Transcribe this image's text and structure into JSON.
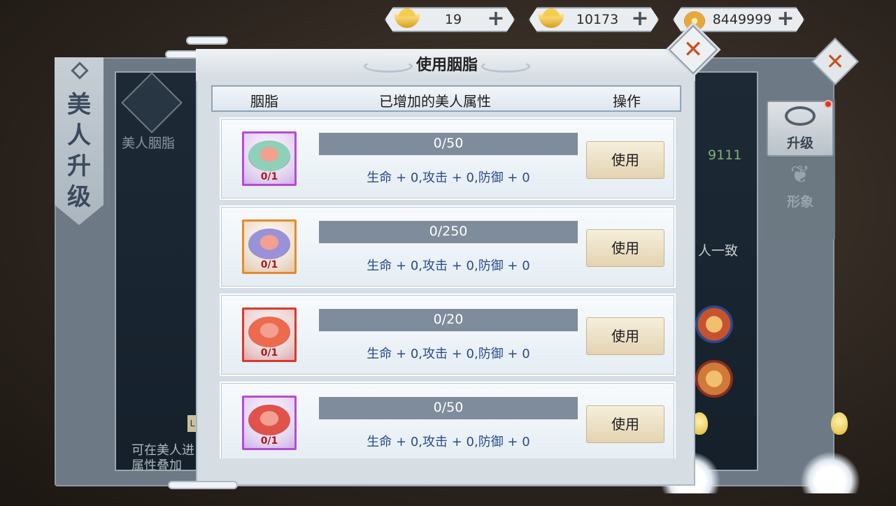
{
  "currencies": [
    {
      "icon": "locked-ingot-icon",
      "value": "19"
    },
    {
      "icon": "gold-ingot-icon",
      "value": "10173"
    },
    {
      "icon": "copper-coin-icon",
      "value": "8449999"
    }
  ],
  "background": {
    "side_title": "美人升级",
    "section_label": "美人胭脂",
    "number": "9111",
    "text_right": "人一致",
    "level_badge": "L",
    "hint_line1": "可在美人进",
    "hint_line2": "属性叠加",
    "tabs": [
      {
        "label": "升级",
        "icon": "upgrade-icon"
      },
      {
        "label": "形象",
        "icon": "appearance-icon"
      }
    ]
  },
  "dialog": {
    "title": "使用胭脂",
    "headers": {
      "item": "胭脂",
      "attributes": "已增加的美人属性",
      "action": "操作"
    },
    "rows": [
      {
        "progress": "0/50",
        "count": "0/1",
        "attributes": "生命 + 0,攻击 + 0,防御 + 0",
        "button": "使用",
        "quality_color": "#b64bd6",
        "rouge_color": "#8fd0b8",
        "icon": "rouge-jade-box-icon"
      },
      {
        "progress": "0/250",
        "count": "0/1",
        "attributes": "生命 + 0,攻击 + 0,防御 + 0",
        "button": "使用",
        "quality_color": "#e58a2a",
        "rouge_color": "#9a92d8",
        "icon": "rouge-violet-box-icon"
      },
      {
        "progress": "0/20",
        "count": "0/1",
        "attributes": "生命 + 0,攻击 + 0,防御 + 0",
        "button": "使用",
        "quality_color": "#d9392e",
        "rouge_color": "#ee6a4e",
        "icon": "rouge-red-box-icon"
      },
      {
        "progress": "0/50",
        "count": "0/1",
        "attributes": "生命 + 0,攻击 + 0,防御 + 0",
        "button": "使用",
        "quality_color": "#b64bd6",
        "rouge_color": "#e0524a",
        "icon": "rouge-ornate-box-icon"
      }
    ]
  }
}
